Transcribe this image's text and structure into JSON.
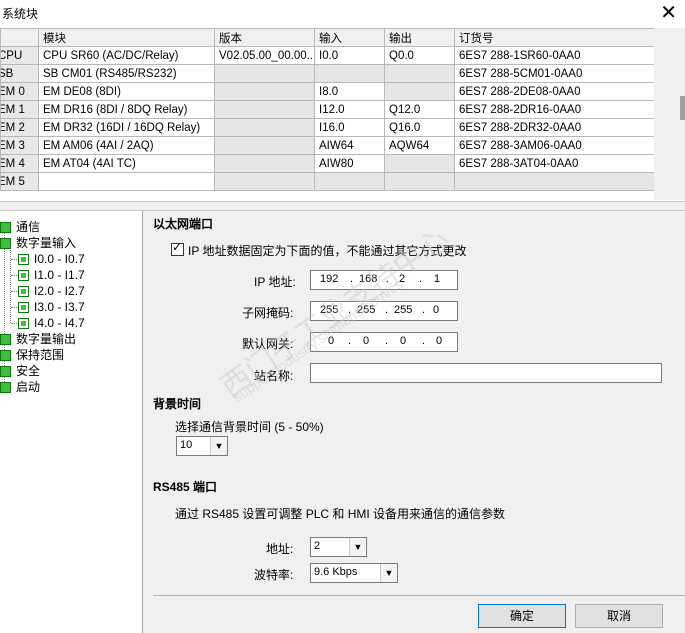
{
  "window": {
    "title": "系统块",
    "close_glyph": "✕"
  },
  "table": {
    "headers": [
      "",
      "模块",
      "版本",
      "输入",
      "输出",
      "订货号"
    ],
    "rows": [
      {
        "slot": "CPU",
        "module": "CPU SR60 (AC/DC/Relay)",
        "version": "V02.05.00_00.00...",
        "input": "I0.0",
        "output": "Q0.0",
        "order": "6ES7 288-1SR60-0AA0"
      },
      {
        "slot": "SB",
        "module": "SB CM01 (RS485/RS232)",
        "version": "",
        "input": "",
        "output": "",
        "order": "6ES7 288-5CM01-0AA0"
      },
      {
        "slot": "EM 0",
        "module": "EM DE08 (8DI)",
        "version": "",
        "input": "I8.0",
        "output": "",
        "order": "6ES7 288-2DE08-0AA0"
      },
      {
        "slot": "EM 1",
        "module": "EM DR16 (8DI / 8DQ Relay)",
        "version": "",
        "input": "I12.0",
        "output": "Q12.0",
        "order": "6ES7 288-2DR16-0AA0"
      },
      {
        "slot": "EM 2",
        "module": "EM DR32 (16DI / 16DQ Relay)",
        "version": "",
        "input": "I16.0",
        "output": "Q16.0",
        "order": "6ES7 288-2DR32-0AA0"
      },
      {
        "slot": "EM 3",
        "module": "EM AM06 (4AI / 2AQ)",
        "version": "",
        "input": "AIW64",
        "output": "AQW64",
        "order": "6ES7 288-3AM06-0AA0"
      },
      {
        "slot": "EM 4",
        "module": "EM AT04 (4AI TC)",
        "version": "",
        "input": "AIW80",
        "output": "",
        "order": "6ES7 288-3AT04-0AA0"
      },
      {
        "slot": "EM 5",
        "module": "",
        "version": "",
        "input": "",
        "output": "",
        "order": ""
      }
    ]
  },
  "tree": {
    "items": [
      "通信",
      "数字量输入",
      "I0.0 - I0.7",
      "I1.0 - I1.7",
      "I2.0 - I2.7",
      "I3.0 - I3.7",
      "I4.0 - I4.7",
      "数字量输出",
      "保持范围",
      "安全",
      "启动"
    ]
  },
  "ethernet": {
    "heading": "以太网端口",
    "fixed_ip_label": "IP 地址数据固定为下面的值，不能通过其它方式更改",
    "fixed_ip_checked": true,
    "ip_label": "IP 地址:",
    "ip": [
      "192",
      "168",
      "2",
      "1"
    ],
    "mask_label": "子网掩码:",
    "mask": [
      "255",
      "255",
      "255",
      "0"
    ],
    "gateway_label": "默认网关:",
    "gateway": [
      "0",
      "0",
      "0",
      "0"
    ],
    "station_label": "站名称:",
    "station_value": ""
  },
  "background": {
    "heading": "背景时间",
    "label": "选择通信背景时间 (5 - 50%)",
    "value": "10"
  },
  "rs485": {
    "heading": "RS485 端口",
    "description": "通过 RS485 设置可调整 PLC 和 HMI 设备用来通信的通信参数",
    "address_label": "地址:",
    "address_value": "2",
    "baud_label": "波特率:",
    "baud_value": "9.6 Kbps"
  },
  "buttons": {
    "ok": "确定",
    "cancel": "取消"
  },
  "watermark": {
    "text1": "西门子工业支持中心",
    "text2": "support.industry.siemens.com/cs"
  },
  "colors": {
    "tree_icon": "#3fbf3f",
    "default_button_border": "#0078d7"
  }
}
